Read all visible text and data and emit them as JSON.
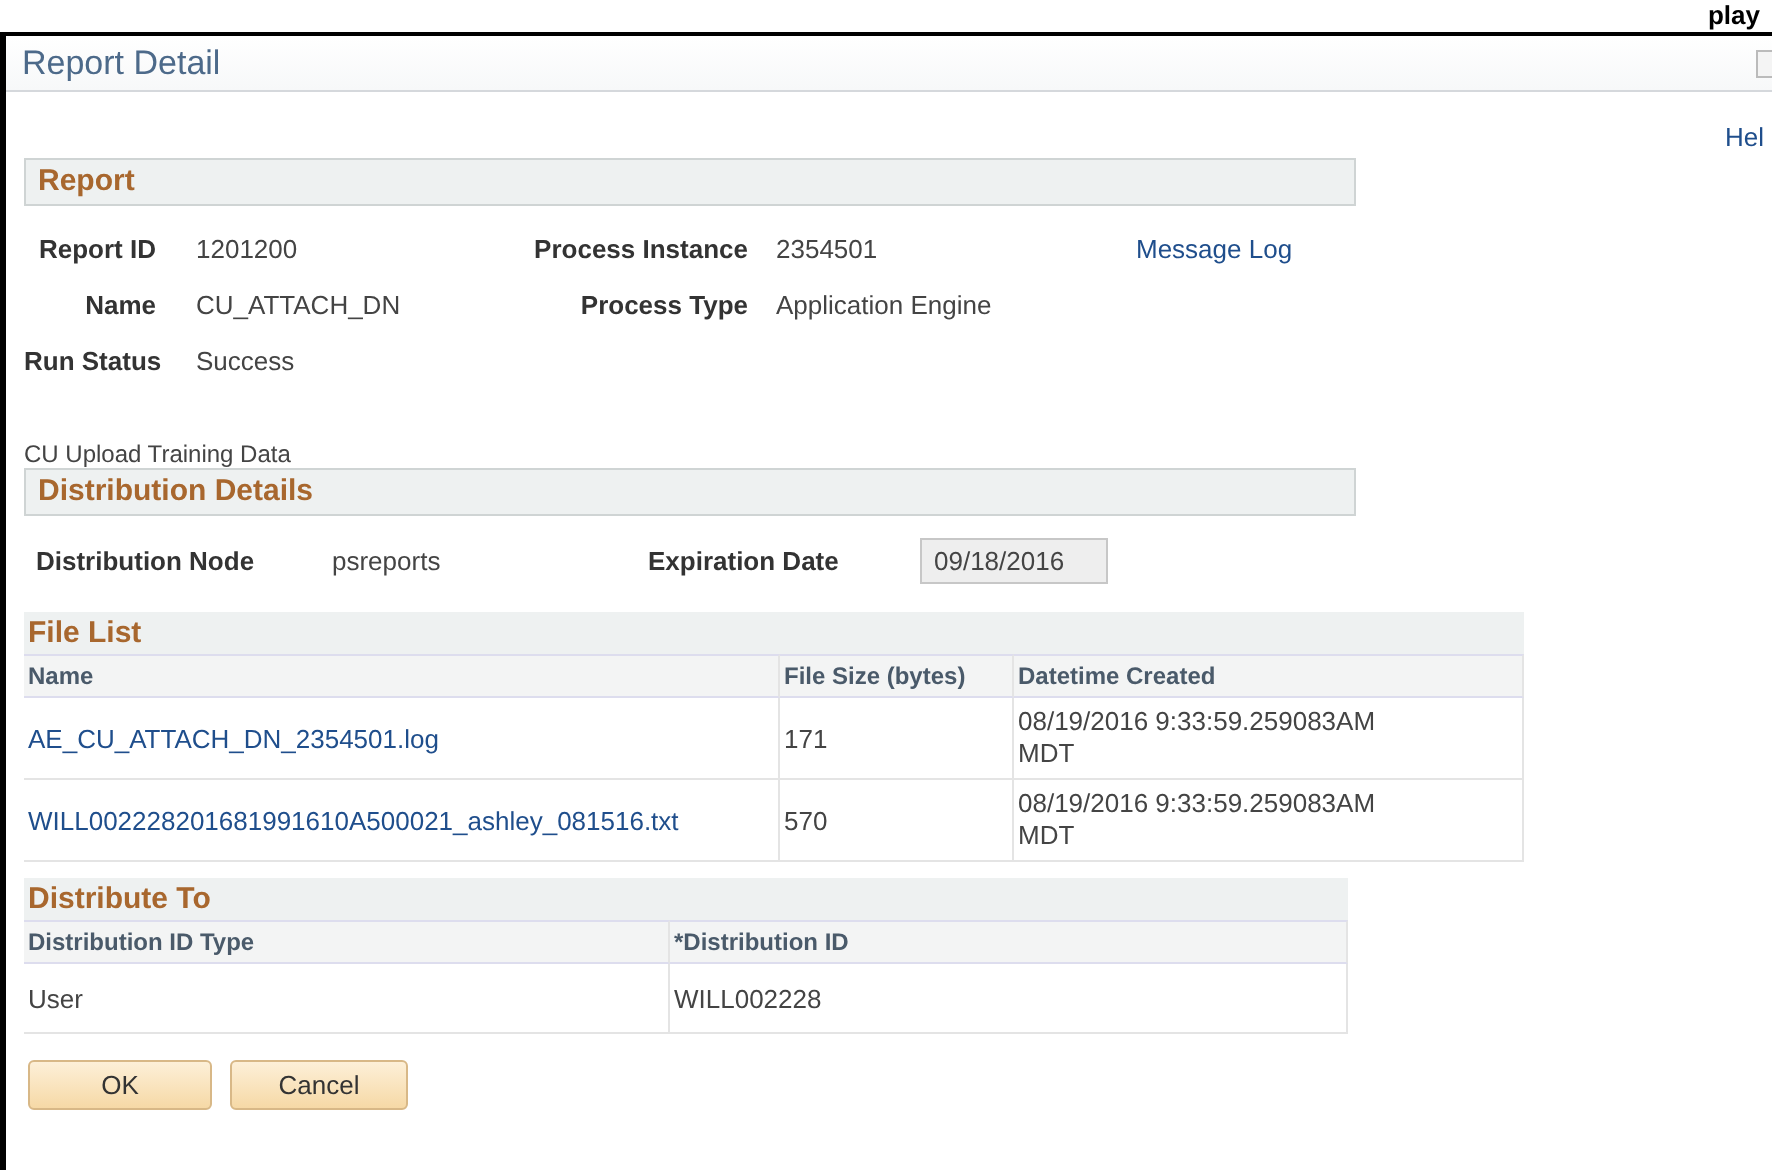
{
  "top_caption": "play",
  "title": "Report Detail",
  "help_link": "Hel",
  "report": {
    "heading": "Report",
    "rows": [
      [
        {
          "label": "Report ID",
          "value": "1201200"
        },
        {
          "label": "Process Instance",
          "value": "2354501"
        }
      ],
      [
        {
          "label": "Name",
          "value": "CU_ATTACH_DN"
        },
        {
          "label": "Process Type",
          "value": "Application Engine"
        }
      ],
      [
        {
          "label": "Run Status",
          "value": "Success"
        }
      ]
    ],
    "link": "Message Log"
  },
  "description": "CU Upload Training Data",
  "distribution_details": {
    "heading": "Distribution Details",
    "node_label": "Distribution Node",
    "node": "psreports",
    "expiration_label": "Expiration Date",
    "expiration": "09/18/2016"
  },
  "file_list": {
    "heading": "File List",
    "columns": [
      "Name",
      "File Size (bytes)",
      "Datetime Created"
    ],
    "rows": [
      [
        "AE_CU_ATTACH_DN_2354501.log",
        "171",
        "08/19/2016  9:33:59.259083AM MDT"
      ],
      [
        "WILL002228201681991610A500021_ashley_081516.txt",
        "570",
        "08/19/2016  9:33:59.259083AM MDT"
      ]
    ]
  },
  "distribute_to": {
    "heading": "Distribute To",
    "columns": [
      "Distribution ID Type",
      "*Distribution ID"
    ],
    "rows": [
      [
        "User",
        "WILL002228"
      ]
    ]
  },
  "buttons": [
    "OK",
    "Cancel"
  ]
}
